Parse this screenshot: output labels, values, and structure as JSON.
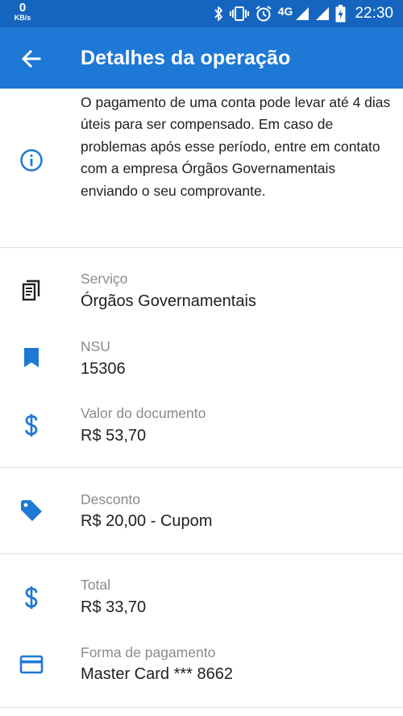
{
  "status_bar": {
    "speed_value": "0",
    "speed_unit": "KB/s",
    "network": "4G",
    "time": "22:30"
  },
  "header": {
    "title": "Detalhes da operação"
  },
  "notice": {
    "text": "O pagamento de uma conta pode levar até 4 dias úteis para ser compensado. Em caso de problemas após esse período, entre em contato com a empresa Órgãos Governamentais enviando o seu comprovante."
  },
  "details": {
    "servico": {
      "label": "Serviço",
      "value": "Órgãos Governamentais",
      "icon": "receipt-icon"
    },
    "nsu": {
      "label": "NSU",
      "value": "15306",
      "icon": "bookmark-icon"
    },
    "valor": {
      "label": "Valor do documento",
      "value": "R$ 53,70",
      "icon": "dollar-icon"
    },
    "desconto": {
      "label": "Desconto",
      "value": "R$ 20,00 - Cupom",
      "icon": "tag-icon"
    },
    "total": {
      "label": "Total",
      "value": "R$ 33,70",
      "icon": "dollar-icon"
    },
    "pagamento": {
      "label": "Forma de pagamento",
      "value": "Master Card *** 8662",
      "icon": "credit-card-icon"
    }
  },
  "colors": {
    "status_bar": "#1565c0",
    "app_bar": "#1e78d6",
    "accent_icon": "#1e78d6",
    "label_gray": "#8a8a8a",
    "divider": "#dedede"
  }
}
